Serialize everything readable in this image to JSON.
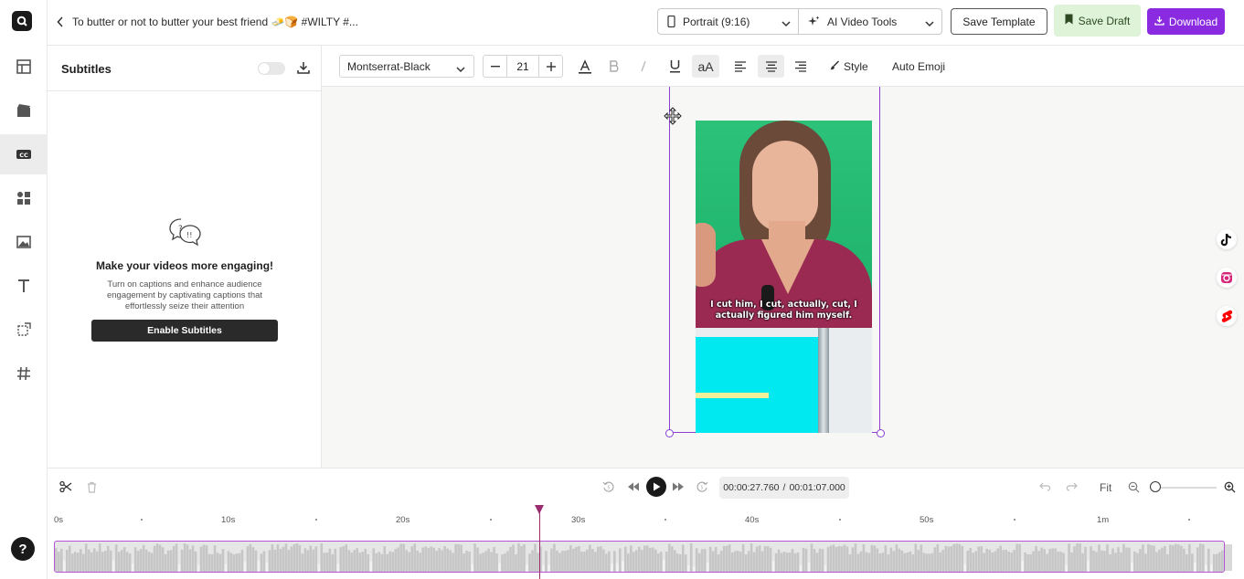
{
  "header": {
    "project_title": "To butter or not to butter your best friend 🧈🍞 #WILTY #...",
    "aspect_select": "Portrait (9:16)",
    "tools_select": "AI Video Tools",
    "save_template": "Save Template",
    "save_draft": "Save Draft",
    "download": "Download"
  },
  "rail": {
    "items": [
      "layout-icon",
      "media-icon",
      "subtitles-icon",
      "elements-icon",
      "images-icon",
      "text-icon",
      "resize-icon",
      "hashtag-icon"
    ],
    "active": "subtitles-icon",
    "help": "?"
  },
  "subtitles_panel": {
    "title": "Subtitles",
    "toggle_on": false,
    "empty_title": "Make your videos more engaging!",
    "empty_desc": "Turn on captions and enhance audience engagement by captivating captions that effortlessly seize their attention",
    "enable_button": "Enable Subtitles"
  },
  "toolbar": {
    "font": "Montserrat-Black",
    "size": "21",
    "case_label": "aA",
    "style_label": "Style",
    "auto_emoji": "Auto Emoji",
    "align_active": "center"
  },
  "video": {
    "caption": "I cut him, I cut, actually, cut, I actually figured him myself."
  },
  "social": [
    "tiktok-icon",
    "instagram-reels-icon",
    "youtube-shorts-icon"
  ],
  "timeline": {
    "current_time": "00:00:27.760",
    "separator": "/",
    "total_time": "00:01:07.000",
    "fit_label": "Fit",
    "ruler": [
      "0s",
      "10s",
      "20s",
      "30s",
      "40s",
      "50s",
      "1m"
    ],
    "playhead_fraction": 0.414
  },
  "colors": {
    "accent": "#8a2be2",
    "draft_bg": "#dff3d9",
    "playhead": "#9b2a6e"
  }
}
